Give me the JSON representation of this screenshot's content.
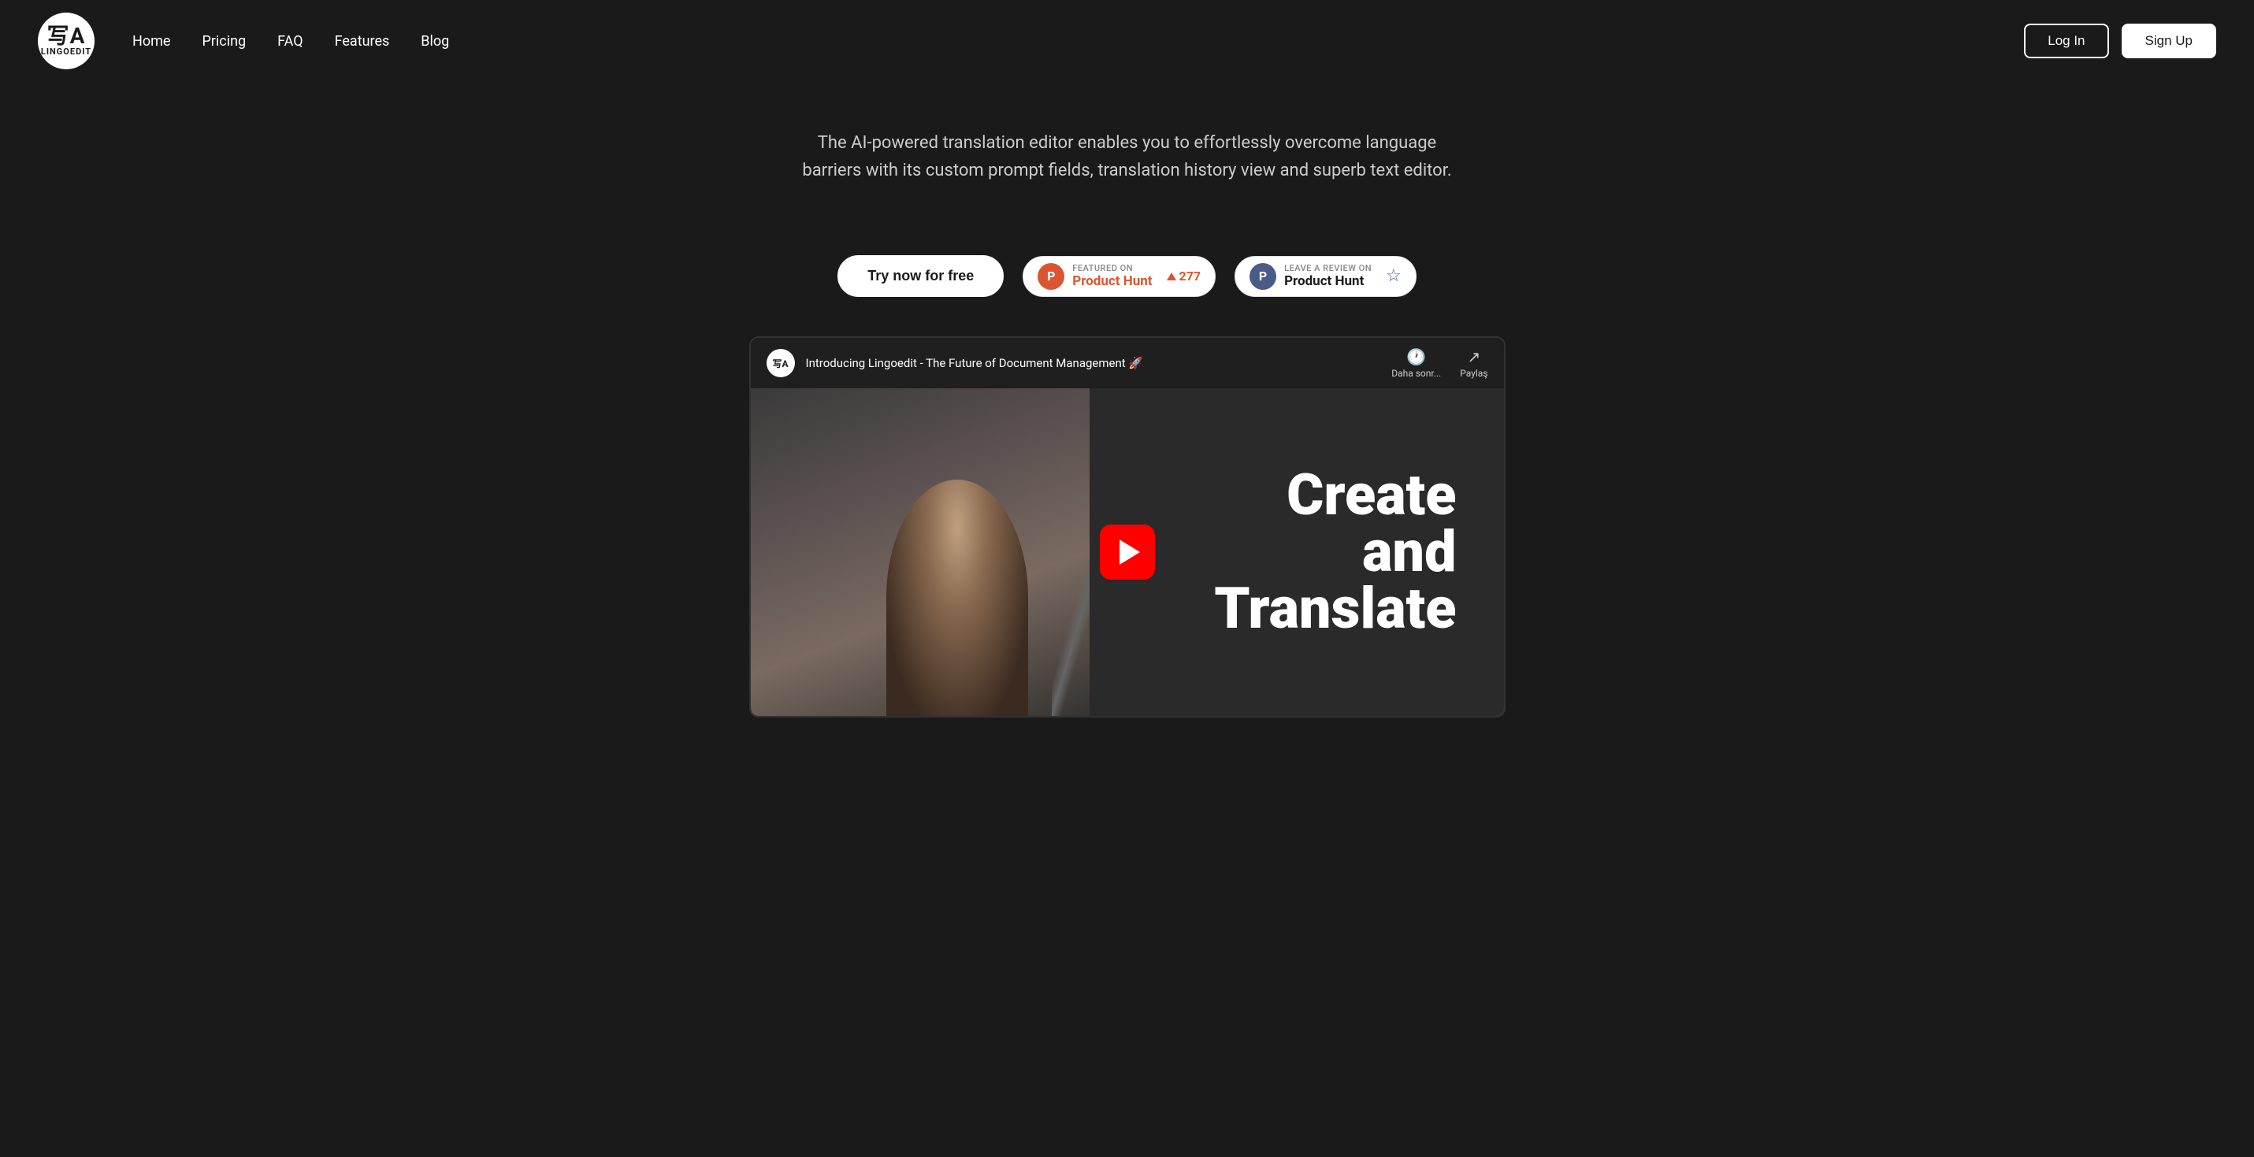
{
  "brand": {
    "name": "LINGOEDIT",
    "logo_symbol": "写A"
  },
  "nav": {
    "links": [
      {
        "label": "Home",
        "href": "#"
      },
      {
        "label": "Pricing",
        "href": "#"
      },
      {
        "label": "FAQ",
        "href": "#"
      },
      {
        "label": "Features",
        "href": "#"
      },
      {
        "label": "Blog",
        "href": "#"
      }
    ],
    "login_label": "Log In",
    "signup_label": "Sign Up"
  },
  "hero": {
    "subtitle": "The AI-powered translation editor enables you to effortlessly overcome language barriers with its custom prompt fields, translation history view and superb text editor."
  },
  "cta": {
    "try_label": "Try now for free",
    "ph_featured_label": "FEATURED ON",
    "ph_name": "Product Hunt",
    "ph_count": "277",
    "ph_review_label": "LEAVE A REVIEW ON",
    "ph_review_name": "Product Hunt"
  },
  "video": {
    "title": "Introducing Lingoedit - The Future of Document Management 🚀",
    "action_later": "Daha sonr...",
    "action_share": "Paylaş",
    "big_text_line1": "Create",
    "big_text_line2": "and",
    "big_text_line3": "Translate"
  },
  "colors": {
    "bg": "#1a1a1a",
    "text": "#ffffff",
    "accent_ph": "#da552f",
    "accent_ph_review": "#4a5a8a",
    "play_button": "#ff0000"
  }
}
